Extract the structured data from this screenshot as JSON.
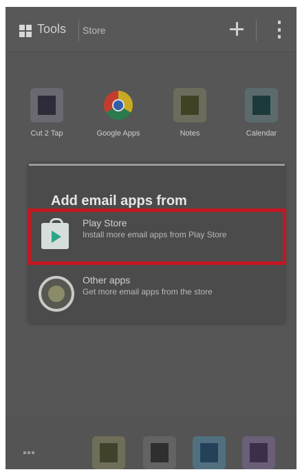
{
  "status_bar": {},
  "action_bar": {
    "apps_tab_label": "Tools",
    "widgets_tab_label": "Store",
    "apps_icon": "grid-icon",
    "add_icon": "plus-icon",
    "menu_icon": "overflow-menu-icon"
  },
  "apps": [
    {
      "label": "Cut 2 Tap",
      "icon": "app-icon",
      "color": "#2f2b3a"
    },
    {
      "label": "Google Apps",
      "icon": "chrome-icon",
      "color": "#d9412d"
    },
    {
      "label": "Notes",
      "icon": "app-icon",
      "color": "#3f4224"
    },
    {
      "label": "Calendar",
      "icon": "app-icon",
      "color": "#1d3a3b"
    }
  ],
  "dialog": {
    "title": "Add email apps from",
    "options": [
      {
        "name": "Play Store",
        "description": "Install more email apps from Play Store",
        "icon": "play-store-icon",
        "highlighted": true
      },
      {
        "name": "Other apps",
        "description": "Get more email apps from the store",
        "icon": "app-circle-icon",
        "highlighted": false
      }
    ]
  },
  "dock": [
    {
      "icon": "app-icon",
      "color": "#42412a"
    },
    {
      "icon": "app-icon",
      "color": "#2f2f2f"
    },
    {
      "icon": "app-icon",
      "color": "#23425a"
    },
    {
      "icon": "app-icon",
      "color": "#3b2f4b"
    }
  ],
  "colors": {
    "highlight": "#c41822",
    "background": "#565656"
  }
}
